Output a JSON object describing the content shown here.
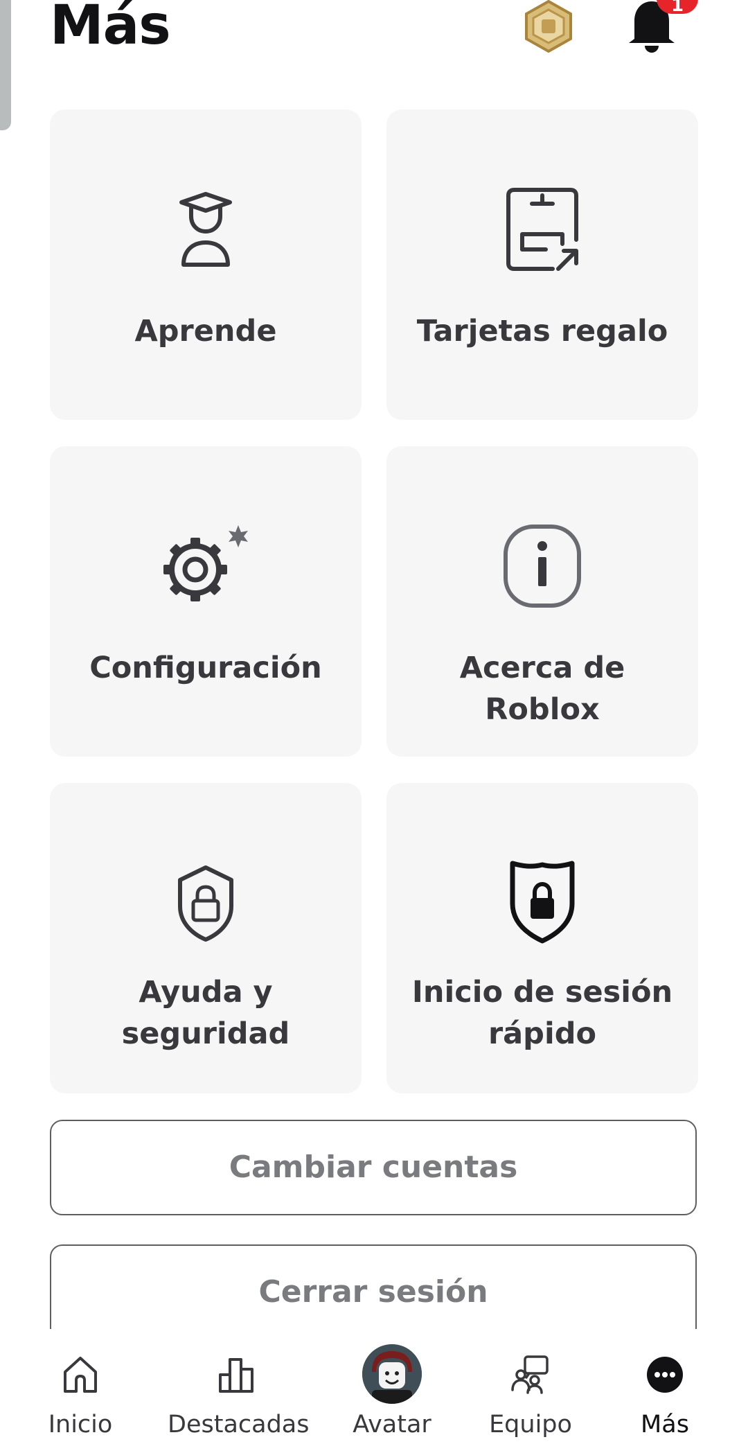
{
  "header": {
    "title": "Más",
    "notification_count": "1"
  },
  "tiles": [
    {
      "label": "Aprende",
      "icon": "graduate-icon"
    },
    {
      "label": "Tarjetas regalo",
      "icon": "gift-card-icon"
    },
    {
      "label": "Configuración",
      "icon": "gear-icon"
    },
    {
      "label": "Acerca de Roblox",
      "icon": "info-icon"
    },
    {
      "label": "Ayuda y seguridad",
      "icon": "shield-lock-outline-icon"
    },
    {
      "label": "Inicio de sesión rápido",
      "icon": "shield-lock-filled-icon"
    }
  ],
  "buttons": {
    "switch_accounts": "Cambiar cuentas",
    "logout": "Cerrar sesión"
  },
  "nav": {
    "items": [
      {
        "label": "Inicio",
        "icon": "home-icon"
      },
      {
        "label": "Destacadas",
        "icon": "charts-icon"
      },
      {
        "label": "Avatar",
        "icon": "avatar-icon"
      },
      {
        "label": "Equipo",
        "icon": "team-icon"
      },
      {
        "label": "Más",
        "icon": "more-icon",
        "active": true
      }
    ]
  },
  "colors": {
    "tile_bg": "#f6f6f7",
    "badge": "#e5252a",
    "robux_gold": "#c9a95a",
    "text_dark": "#39393d"
  }
}
